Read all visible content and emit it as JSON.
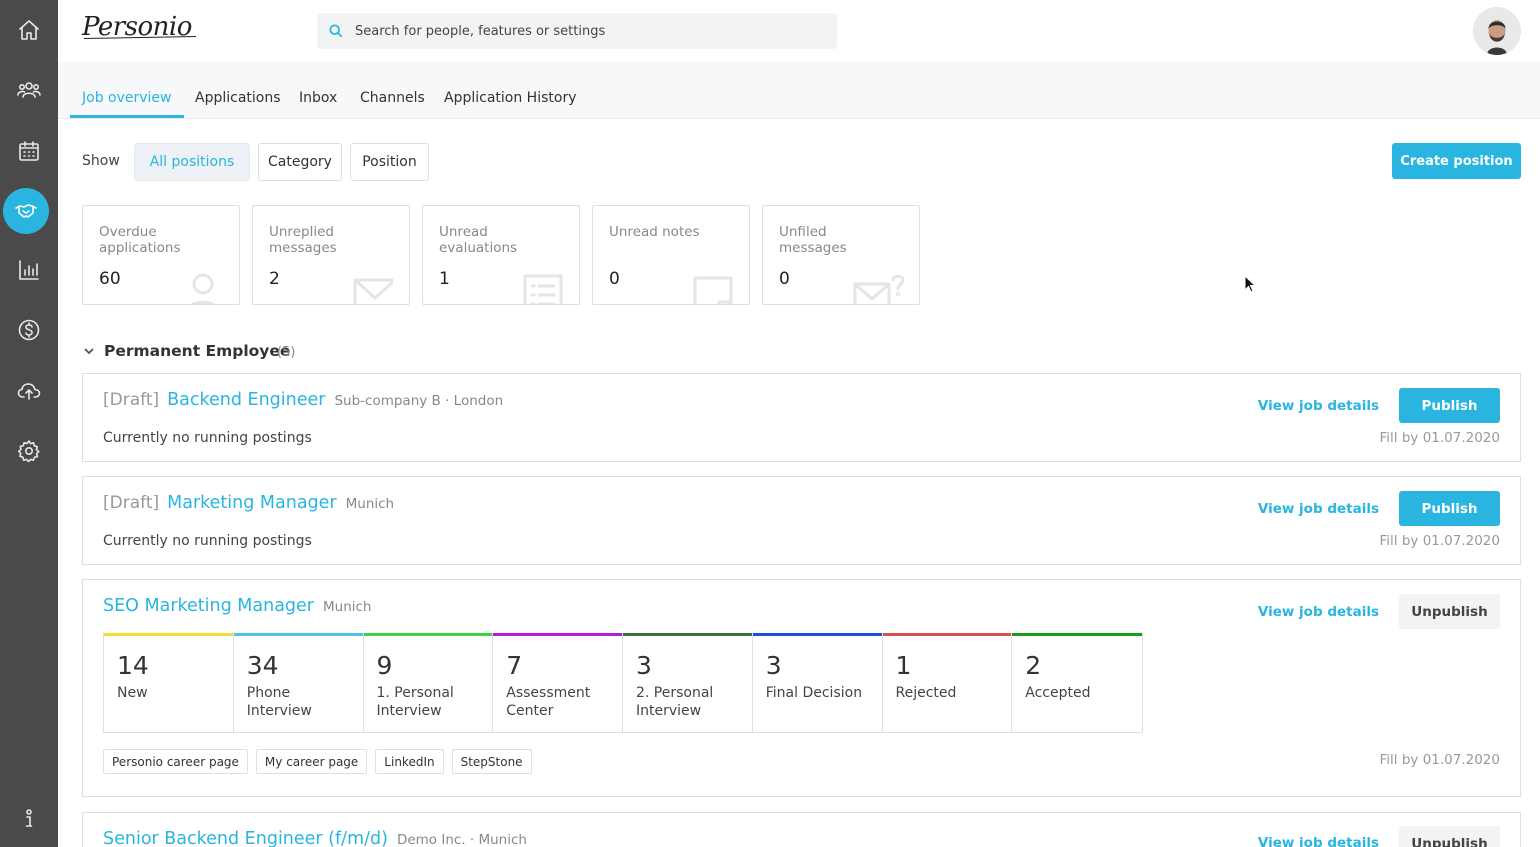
{
  "brand": {
    "logo_text": "Personio",
    "accent": "#29b5df"
  },
  "sidebar": {
    "items": [
      {
        "name": "home",
        "icon": "home-icon"
      },
      {
        "name": "people",
        "icon": "people-icon"
      },
      {
        "name": "calendar",
        "icon": "calendar-icon"
      },
      {
        "name": "recruiting",
        "icon": "handshake-icon",
        "active": true
      },
      {
        "name": "reports",
        "icon": "bar-chart-icon"
      },
      {
        "name": "payroll",
        "icon": "dollar-icon"
      },
      {
        "name": "upload",
        "icon": "cloud-upload-icon"
      },
      {
        "name": "settings",
        "icon": "gear-icon"
      },
      {
        "name": "help",
        "icon": "info-icon"
      }
    ]
  },
  "search": {
    "placeholder": "Search for people, features or settings"
  },
  "tabs": [
    {
      "label": "Job overview",
      "active": true
    },
    {
      "label": "Applications"
    },
    {
      "label": "Inbox"
    },
    {
      "label": "Channels"
    },
    {
      "label": "Application History"
    }
  ],
  "filter": {
    "show_label": "Show",
    "options": [
      {
        "label": "All positions",
        "active": true
      },
      {
        "label": "Category"
      },
      {
        "label": "Position"
      }
    ],
    "create_label": "Create position"
  },
  "stats": [
    {
      "label": "Overdue applications",
      "value": "60",
      "icon": "person-icon"
    },
    {
      "label": "Unreplied messages",
      "value": "2",
      "icon": "envelope-icon"
    },
    {
      "label": "Unread evaluations",
      "value": "1",
      "icon": "list-icon"
    },
    {
      "label": "Unread notes",
      "value": "0",
      "icon": "note-icon"
    },
    {
      "label": "Unfiled messages",
      "value": "0",
      "icon": "envelope-question-icon"
    }
  ],
  "section": {
    "title": "Permanent Employee",
    "count": "(5)"
  },
  "jobs": [
    {
      "draft": "[Draft]",
      "title": "Backend Engineer",
      "meta": "Sub-company B · London",
      "no_postings": "Currently no running postings",
      "view_label": "View job details",
      "action_label": "Publish",
      "fill_by": "Fill by 01.07.2020"
    },
    {
      "draft": "[Draft]",
      "title": "Marketing Manager",
      "meta": "Munich",
      "no_postings": "Currently no running postings",
      "view_label": "View job details",
      "action_label": "Publish",
      "fill_by": "Fill by 01.07.2020"
    },
    {
      "title": "SEO Marketing Manager",
      "meta": "Munich",
      "view_label": "View job details",
      "action_label": "Unpublish",
      "fill_by": "Fill by 01.07.2020",
      "stages": [
        {
          "count": "14",
          "label": "New",
          "color": "#f0e130"
        },
        {
          "count": "34",
          "label": "Phone Interview",
          "color": "#4fc3e8"
        },
        {
          "count": "9",
          "label": "1. Personal Interview",
          "color": "#3fcf3f"
        },
        {
          "count": "7",
          "label": "Assessment Center",
          "color": "#b31fd8"
        },
        {
          "count": "3",
          "label": "2. Personal Interview",
          "color": "#3f6f3f"
        },
        {
          "count": "3",
          "label": "Final Decision",
          "color": "#1d4fd6"
        },
        {
          "count": "1",
          "label": "Rejected",
          "color": "#d9534f"
        },
        {
          "count": "2",
          "label": "Accepted",
          "color": "#1a9a1a"
        }
      ],
      "channels": [
        "Personio career page",
        "My career page",
        "LinkedIn",
        "StepStone"
      ]
    },
    {
      "title": "Senior Backend Engineer (f/m/d)",
      "meta": "Demo Inc. · Munich",
      "view_label": "View job details",
      "action_label": "Unpublish"
    }
  ]
}
